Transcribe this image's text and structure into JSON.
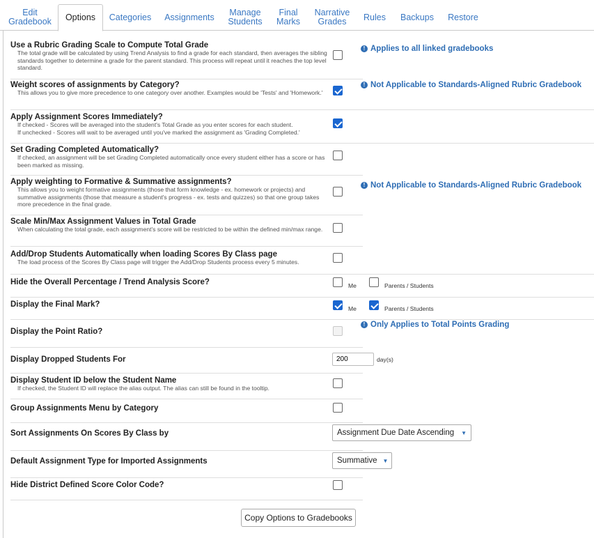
{
  "tabs": [
    {
      "line1": "Edit",
      "line2": "Gradebook"
    },
    {
      "line1": "Options",
      "line2": ""
    },
    {
      "line1": "Categories",
      "line2": ""
    },
    {
      "line1": "Assignments",
      "line2": ""
    },
    {
      "line1": "Manage",
      "line2": "Students"
    },
    {
      "line1": "Final",
      "line2": "Marks"
    },
    {
      "line1": "Narrative",
      "line2": "Grades"
    },
    {
      "line1": "Rules",
      "line2": ""
    },
    {
      "line1": "Backups",
      "line2": ""
    },
    {
      "line1": "Restore",
      "line2": ""
    }
  ],
  "active_tab": "Options",
  "options": [
    {
      "title": "Use a Rubric Grading Scale to Compute Total Grade",
      "desc": "The total grade will be calculated by using Trend Analysis to find a grade for each standard, then averages the sibling standards together to determine a grade for the parent standard. This process will repeat until it reaches the top level standard.",
      "checked": false,
      "note": "Applies to all linked gradebooks"
    },
    {
      "title": "Weight scores of assignments by Category?",
      "desc": "This allows you to give more precedence to one category over another. Examples would be 'Tests' and 'Homework.'",
      "checked": true,
      "note": "Not Applicable to Standards-Aligned Rubric Gradebook"
    },
    {
      "title": "Apply Assignment Scores Immediately?",
      "desc1": "If checked - Scores will be averaged into the student's Total Grade as you enter scores for each student.",
      "desc2": "If unchecked - Scores will wait to be averaged until you've marked the assignment as 'Grading Completed.'",
      "checked": true
    },
    {
      "title": "Set Grading Completed Automatically?",
      "desc": "If checked, an assignment will be set Grading Completed automatically once every student either has a score or has been marked as missing.",
      "checked": false
    },
    {
      "title": "Apply weighting to Formative & Summative assignments?",
      "desc": "This allows you to weight formative assignments (those that form knowledge - ex. homework or projects) and summative assignments (those that measure a student's progress - ex. tests and quizzes) so that one group takes more precedence in the final grade.",
      "checked": false,
      "note": "Not Applicable to Standards-Aligned Rubric Gradebook"
    },
    {
      "title": "Scale Min/Max Assignment Values in Total Grade",
      "desc": "When calculating the total grade, each assignment's score will be restricted to be within the defined min/max range.",
      "checked": false
    },
    {
      "title": "Add/Drop Students Automatically when loading Scores By Class page",
      "desc": "The load process of the Scores By Class page will trigger the Add/Drop Students process every 5 minutes.",
      "checked": false
    },
    {
      "title": "Hide the Overall Percentage / Trend Analysis Score?",
      "me_label": "Me",
      "me_checked": false,
      "ps_label": "Parents / Students",
      "ps_checked": false
    },
    {
      "title": "Display the Final Mark?",
      "me_label": "Me",
      "me_checked": true,
      "ps_label": "Parents / Students",
      "ps_checked": true
    },
    {
      "title": "Display the Point Ratio?",
      "checked": false,
      "disabled": true,
      "note": "Only Applies to Total Points Grading"
    },
    {
      "title": "Display Dropped Students For",
      "value": "200",
      "unit": "day(s)"
    },
    {
      "title": "Display Student ID below the Student Name",
      "desc": "If checked, the Student ID will replace the alias output. The alias can still be found in the tooltip.",
      "checked": false
    },
    {
      "title": "Group Assignments Menu by Category",
      "checked": false
    },
    {
      "title": "Sort Assignments On Scores By Class by",
      "selected": "Assignment Due Date Ascending"
    },
    {
      "title": "Default Assignment Type for Imported Assignments",
      "selected": "Summative"
    },
    {
      "title": "Hide District Defined Score Color Code?",
      "checked": false
    }
  ],
  "copy_button_label": "Copy Options to Gradebooks",
  "icons": {
    "info": "info-circle-icon",
    "dropdown": "caret-down-icon",
    "check": "checkmark-icon"
  },
  "colors": {
    "link": "#3a78c3",
    "note": "#2e6db4",
    "checkbox_checked": "#1a66d0"
  }
}
